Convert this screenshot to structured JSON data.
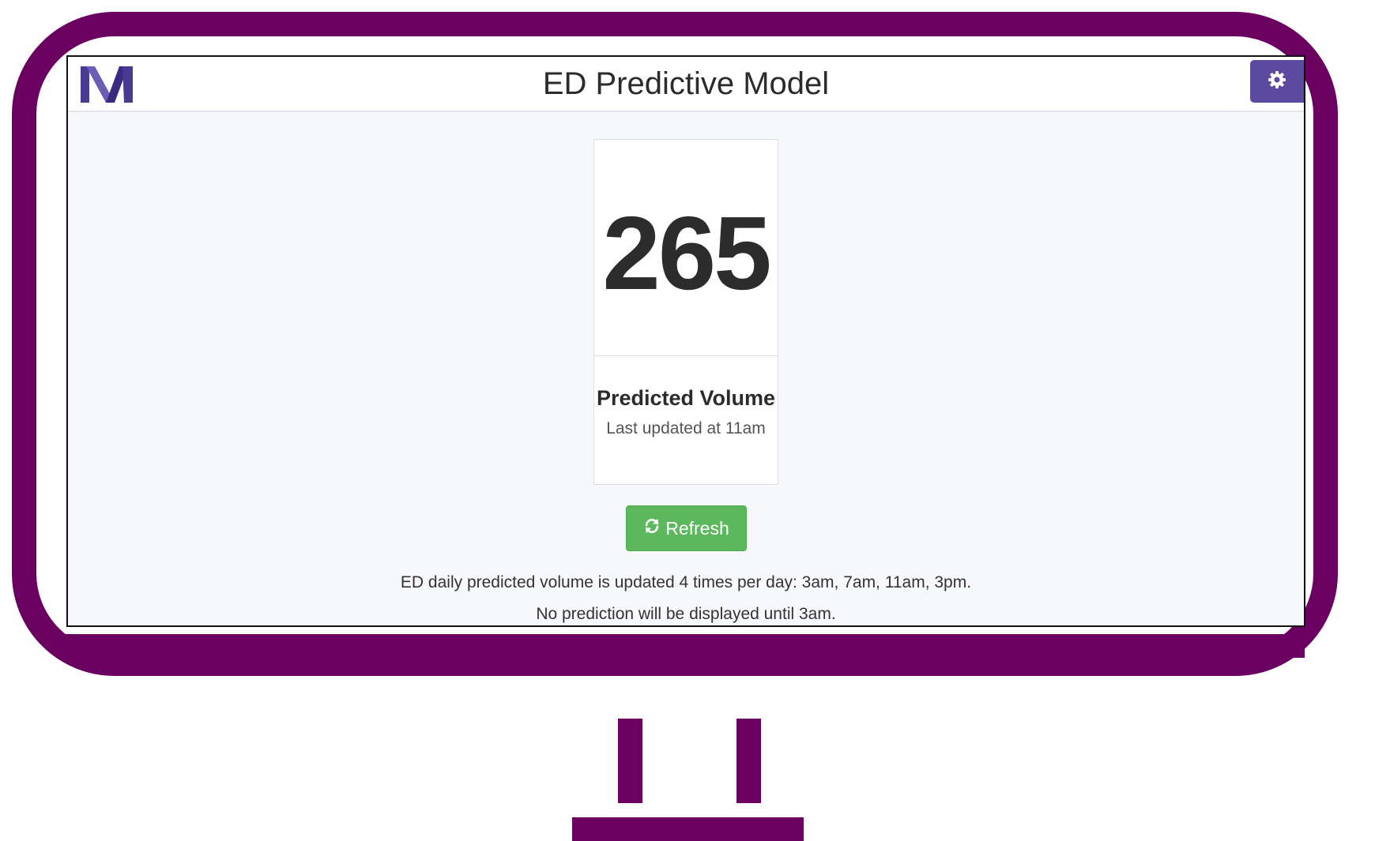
{
  "app": {
    "title": "ED Predictive Model",
    "logo": "NM"
  },
  "header": {
    "settings_icon": "gear-icon"
  },
  "prediction": {
    "value": "265",
    "label": "Predicted Volume",
    "last_updated": "Last updated at 11am"
  },
  "actions": {
    "refresh_label": "Refresh",
    "refresh_icon": "refresh-icon"
  },
  "info": {
    "schedule": "ED daily predicted volume is updated 4 times per day: 3am, 7am, 11am, 3pm.",
    "notice": "No prediction will be displayed until 3am."
  },
  "colors": {
    "monitor_frame": "#6a0060",
    "settings_button": "#5c4aa0",
    "logo": "#4b3a94",
    "refresh_button": "#5cb85c",
    "background": "#f7f8fc"
  }
}
